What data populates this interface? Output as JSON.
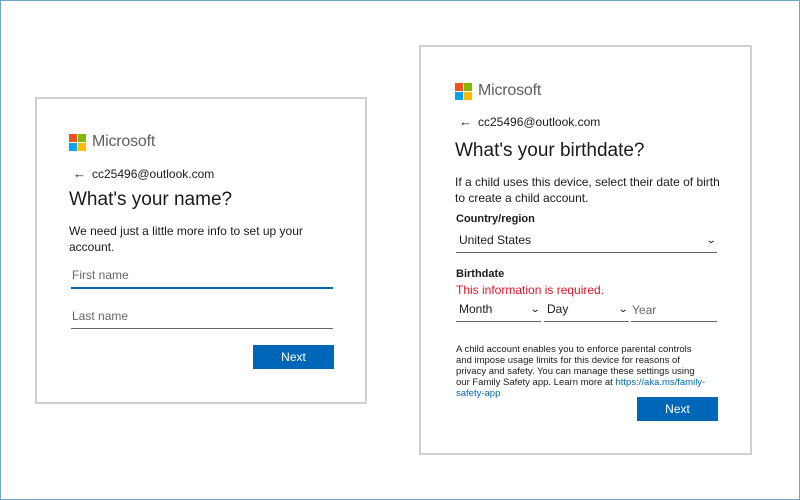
{
  "colors": {
    "accent": "#0067b8",
    "error": "#e81123",
    "logo_red": "#f25022",
    "logo_green": "#7fba00",
    "logo_blue": "#00a4ef",
    "logo_yellow": "#ffb900"
  },
  "name_card": {
    "logo_text": "Microsoft",
    "back_icon": "back-arrow-icon",
    "email": "cc25496@outlook.com",
    "title": "What's your name?",
    "description": "We need just a little more info to set up your account.",
    "first_name_placeholder": "First name",
    "first_name_value": "",
    "last_name_placeholder": "Last name",
    "last_name_value": "",
    "next_label": "Next"
  },
  "birth_card": {
    "logo_text": "Microsoft",
    "back_icon": "back-arrow-icon",
    "email": "cc25496@outlook.com",
    "title": "What's your birthdate?",
    "description": "If a child uses this device, select their date of birth to create a child account.",
    "country_label": "Country/region",
    "country_value": "United States",
    "birthdate_label": "Birthdate",
    "error_text": "This information is required.",
    "month_value": "Month",
    "day_value": "Day",
    "year_placeholder": "Year",
    "fine_print": "A child account enables you to enforce parental controls and impose usage limits for this device for reasons of privacy and safety. You can manage these settings using our Family Safety app. Learn more at ",
    "fine_link": "https://aka.ms/family-safety-app",
    "next_label": "Next"
  }
}
